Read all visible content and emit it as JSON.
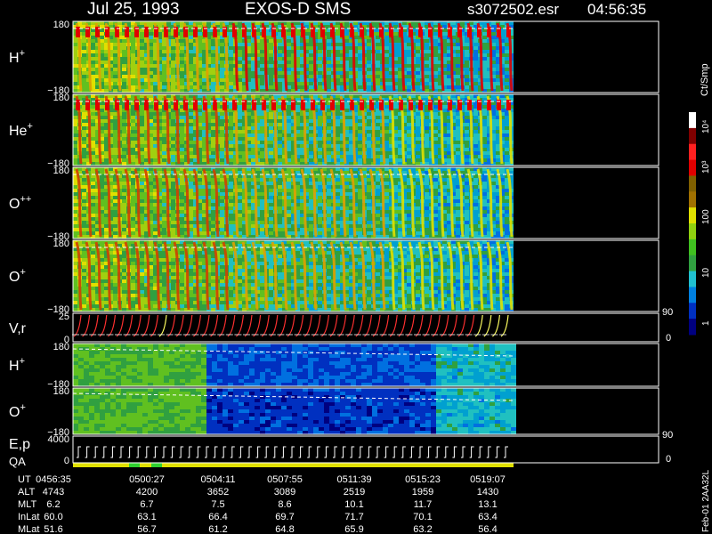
{
  "header": {
    "date": "Jul 25, 1993",
    "instrument": "EXOS-D SMS",
    "file": "s3072502.esr",
    "time": "04:56:35"
  },
  "panels": [
    {
      "label": "H",
      "sup": "+",
      "top_tick": "180",
      "bottom_tick": "−180"
    },
    {
      "label": "He",
      "sup": "+",
      "top_tick": "180",
      "bottom_tick": "−180"
    },
    {
      "label": "O",
      "sup": "++",
      "top_tick": "180",
      "bottom_tick": "−180"
    },
    {
      "label": "O",
      "sup": "+",
      "top_tick": "180",
      "bottom_tick": "−180"
    },
    {
      "label": "V,r",
      "sup": "",
      "top_tick": "25",
      "bottom_tick": "0",
      "right_top": "90",
      "right_bottom": "0"
    },
    {
      "label": "H",
      "sup": "+",
      "top_tick": "180",
      "bottom_tick": "−180"
    },
    {
      "label": "O",
      "sup": "+",
      "top_tick": "180",
      "bottom_tick": "−180"
    },
    {
      "label": "E,p",
      "label2": "QA",
      "top_tick": "4000",
      "bottom_tick": "0",
      "right_top": "90",
      "right_bottom": "0"
    }
  ],
  "colorbar": {
    "unit": "Ct/Smp",
    "ticks": [
      "10⁴",
      "10³",
      "100",
      "10",
      "1"
    ]
  },
  "footer": {
    "row_labels": [
      "UT",
      "ALT",
      "MLT",
      "InLat",
      "MLat"
    ],
    "columns": [
      [
        "0456:35",
        "4743",
        "6.2",
        "60.0",
        "51.6"
      ],
      [
        "0500:27",
        "4200",
        "6.7",
        "63.1",
        "56.7"
      ],
      [
        "0504:11",
        "3652",
        "7.5",
        "66.4",
        "61.2"
      ],
      [
        "0507:55",
        "3089",
        "8.6",
        "69.7",
        "64.8"
      ],
      [
        "0511:39",
        "2519",
        "10.1",
        "71.7",
        "65.9"
      ],
      [
        "0515:23",
        "1959",
        "11.7",
        "70.1",
        "63.2"
      ],
      [
        "0519:07",
        "1430",
        "13.1",
        "63.4",
        "56.4"
      ]
    ],
    "stamp": "Feb-01 2AA32L"
  },
  "chart_data": {
    "type": "heatmap",
    "ut": [
      "0456:35",
      "0500:27",
      "0504:11",
      "0507:55",
      "0511:39",
      "0515:23",
      "0519:07"
    ],
    "y_range_pitch": [
      -180,
      180
    ],
    "velocity_range": [
      0,
      25
    ],
    "energy_range": [
      0,
      4000
    ],
    "color_scale": "log",
    "color_range": [
      1,
      10000
    ]
  }
}
